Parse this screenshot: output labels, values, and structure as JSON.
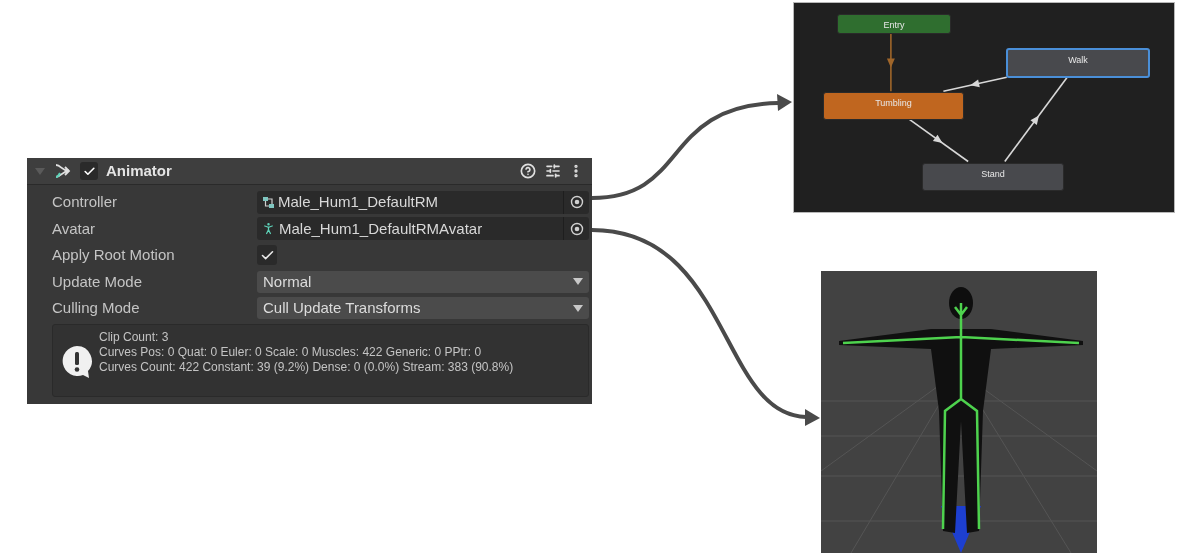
{
  "inspector": {
    "title": "Animator",
    "expanded": true,
    "enabled": true,
    "fields": [
      {
        "kind": "controller",
        "label": "Controller",
        "value": "Male_Hum1_DefaultRM"
      },
      {
        "kind": "avatar",
        "label": "Avatar",
        "value": "Male_Hum1_DefaultRMAvatar"
      },
      {
        "kind": "checkbox",
        "label": "Apply Root Motion",
        "checked": true
      },
      {
        "kind": "dropdown",
        "label": "Update Mode",
        "value": "Normal"
      },
      {
        "kind": "dropdown",
        "label": "Culling Mode",
        "value": "Cull Update Transforms"
      }
    ],
    "info": {
      "lines": [
        "Clip Count: 3",
        "Curves Pos: 0 Quat: 0 Euler: 0 Scale: 0 Muscles: 422 Generic: 0 PPtr: 0",
        "Curves Count: 422 Constant: 39 (9.2%) Dense: 0 (0.0%) Stream: 383 (90.8%)"
      ]
    }
  },
  "state_machine": {
    "states": [
      {
        "name": "Entry",
        "kind": "entry",
        "selected": false
      },
      {
        "name": "Walk",
        "kind": "state",
        "selected": true
      },
      {
        "name": "Tumbling",
        "kind": "default",
        "selected": false
      },
      {
        "name": "Stand",
        "kind": "state",
        "selected": false
      }
    ]
  }
}
